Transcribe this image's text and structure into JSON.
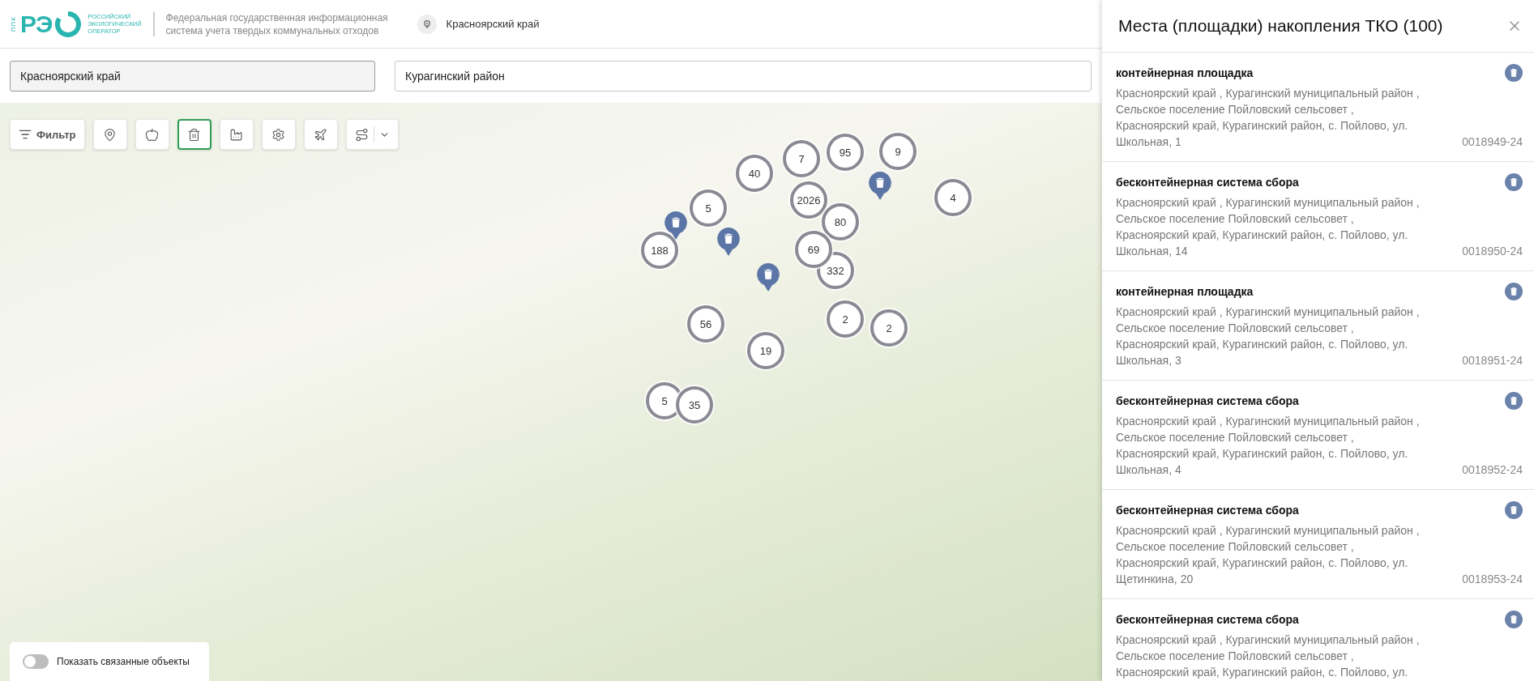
{
  "header": {
    "logo": {
      "abbr": "ППК",
      "mark": "РЭ",
      "lines": [
        "РОССИЙСКИЙ",
        "ЭКОЛОГИЧЕСКИЙ",
        "ОПЕРАТОР"
      ]
    },
    "system_name": [
      "Федеральная государственная информационная",
      "система учета твердых коммунальных отходов"
    ],
    "region": "Красноярский край"
  },
  "filters": {
    "region": "Красноярский край",
    "district": "Курагинский район"
  },
  "toolbar": {
    "filter_label": "Фильтр",
    "tools": [
      {
        "kind": "pin",
        "selected": false
      },
      {
        "kind": "apple",
        "selected": false
      },
      {
        "kind": "trash",
        "selected": true
      },
      {
        "kind": "factory",
        "selected": false
      },
      {
        "kind": "gear",
        "selected": false
      },
      {
        "kind": "plane",
        "selected": false
      },
      {
        "kind": "route",
        "selected": false,
        "dropdown": true
      }
    ]
  },
  "map": {
    "clusters": [
      {
        "count": "40"
      },
      {
        "count": "7"
      },
      {
        "count": "95"
      },
      {
        "count": "9"
      },
      {
        "count": "4"
      },
      {
        "count": "5"
      },
      {
        "count": "2026"
      },
      {
        "count": "80"
      },
      {
        "count": "188"
      },
      {
        "count": "332"
      },
      {
        "count": "69"
      },
      {
        "count": "56"
      },
      {
        "count": "19"
      },
      {
        "count": "2"
      },
      {
        "count": "2"
      },
      {
        "count": "5"
      },
      {
        "count": "35"
      }
    ],
    "pins": [
      {
        "kind": "trash"
      },
      {
        "kind": "trash"
      },
      {
        "kind": "trash"
      },
      {
        "kind": "trash"
      }
    ]
  },
  "linked_toggle": {
    "label": "Показать связанные объекты",
    "on": false
  },
  "panel": {
    "title": "Места (площадки) накопления ТКО (100)",
    "items": [
      {
        "type": "контейнерная площадка",
        "address": "Красноярский край , Курагинский муниципальный район , Сельское поселение Пойловский сельсовет , Красноярский край, Курагинский район, с. Пойлово, ул. Школьная, 1",
        "code": "0018949-24"
      },
      {
        "type": "бесконтейнерная система сбора",
        "address": "Красноярский край , Курагинский муниципальный район , Сельское поселение Пойловский сельсовет , Красноярский край, Курагинский район, с. Пойлово, ул. Школьная, 14",
        "code": "0018950-24"
      },
      {
        "type": "контейнерная площадка",
        "address": "Красноярский край , Курагинский муниципальный район , Сельское поселение Пойловский сельсовет , Красноярский край, Курагинский район, с. Пойлово, ул. Школьная, 3",
        "code": "0018951-24"
      },
      {
        "type": "бесконтейнерная система сбора",
        "address": "Красноярский край , Курагинский муниципальный район , Сельское поселение Пойловский сельсовет , Красноярский край, Курагинский район, с. Пойлово, ул. Школьная, 4",
        "code": "0018952-24"
      },
      {
        "type": "бесконтейнерная система сбора",
        "address": "Красноярский край , Курагинский муниципальный район , Сельское поселение Пойловский сельсовет , Красноярский край, Курагинский район, с. Пойлово, ул. Щетинкина, 20",
        "code": "0018953-24"
      },
      {
        "type": "бесконтейнерная система сбора",
        "address": "Красноярский край , Курагинский муниципальный район , Сельское поселение Пойловский сельсовет , Красноярский край, Курагинский район, с. Пойлово, ул."
      }
    ]
  }
}
